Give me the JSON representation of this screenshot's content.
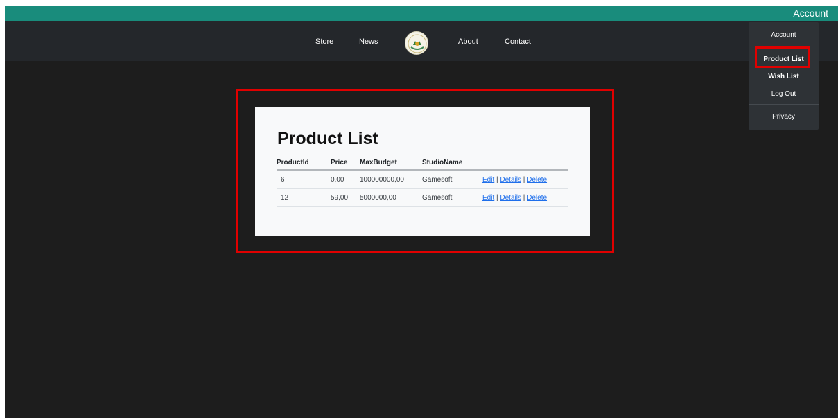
{
  "topbar": {
    "account_label": "Account"
  },
  "navbar": {
    "links": [
      "Store",
      "News",
      "About",
      "Contact"
    ]
  },
  "dropdown": {
    "items": [
      "Account",
      "Product List",
      "Wish List",
      "Log Out",
      "Privacy"
    ]
  },
  "main": {
    "title": "Product List",
    "columns": [
      "ProductId",
      "Price",
      "MaxBudget",
      "StudioName"
    ],
    "rows": [
      {
        "id": "6",
        "price": "0,00",
        "budget": "100000000,00",
        "studio": "Gamesoft"
      },
      {
        "id": "12",
        "price": "59,00",
        "budget": "5000000,00",
        "studio": "Gamesoft"
      }
    ],
    "actions": {
      "edit": "Edit",
      "details": "Details",
      "delete": "Delete",
      "separator": " | "
    }
  },
  "colors": {
    "topbar": "#198c7c",
    "navbar": "#24272b",
    "background": "#1d1d1d",
    "highlight": "#e00000",
    "link": "#1f6feb"
  }
}
